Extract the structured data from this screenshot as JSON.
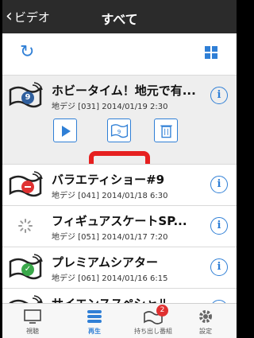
{
  "nav": {
    "back_label": "ビデオ",
    "title": "すべて"
  },
  "items": [
    {
      "title": "ホビータイム！地元で有...",
      "meta": "地デジ [031] 2014/01/19 2:30",
      "badge": "9",
      "status": "blue"
    },
    {
      "title": "バラエティショー#9",
      "meta": "地デジ [041] 2014/01/18 6:30",
      "status": "red"
    },
    {
      "title": "フィギュアスケートSP...",
      "meta": "地デジ [051] 2014/01/17 7:20",
      "status": "loading"
    },
    {
      "title": "プレミアムシアター",
      "meta": "地デジ [061] 2014/01/16 6:15",
      "status": "green"
    },
    {
      "title": "サイエンススペシャル",
      "meta": "",
      "status": "none"
    }
  ],
  "save_icon_badge": "9",
  "tabs": [
    {
      "label": "視聴"
    },
    {
      "label": "再生"
    },
    {
      "label": "持ち出し番組",
      "badge": "2"
    },
    {
      "label": "設定"
    }
  ],
  "colors": {
    "accent": "#2f7fd6",
    "highlight": "#e62020",
    "navbar": "#2b2b2b"
  }
}
